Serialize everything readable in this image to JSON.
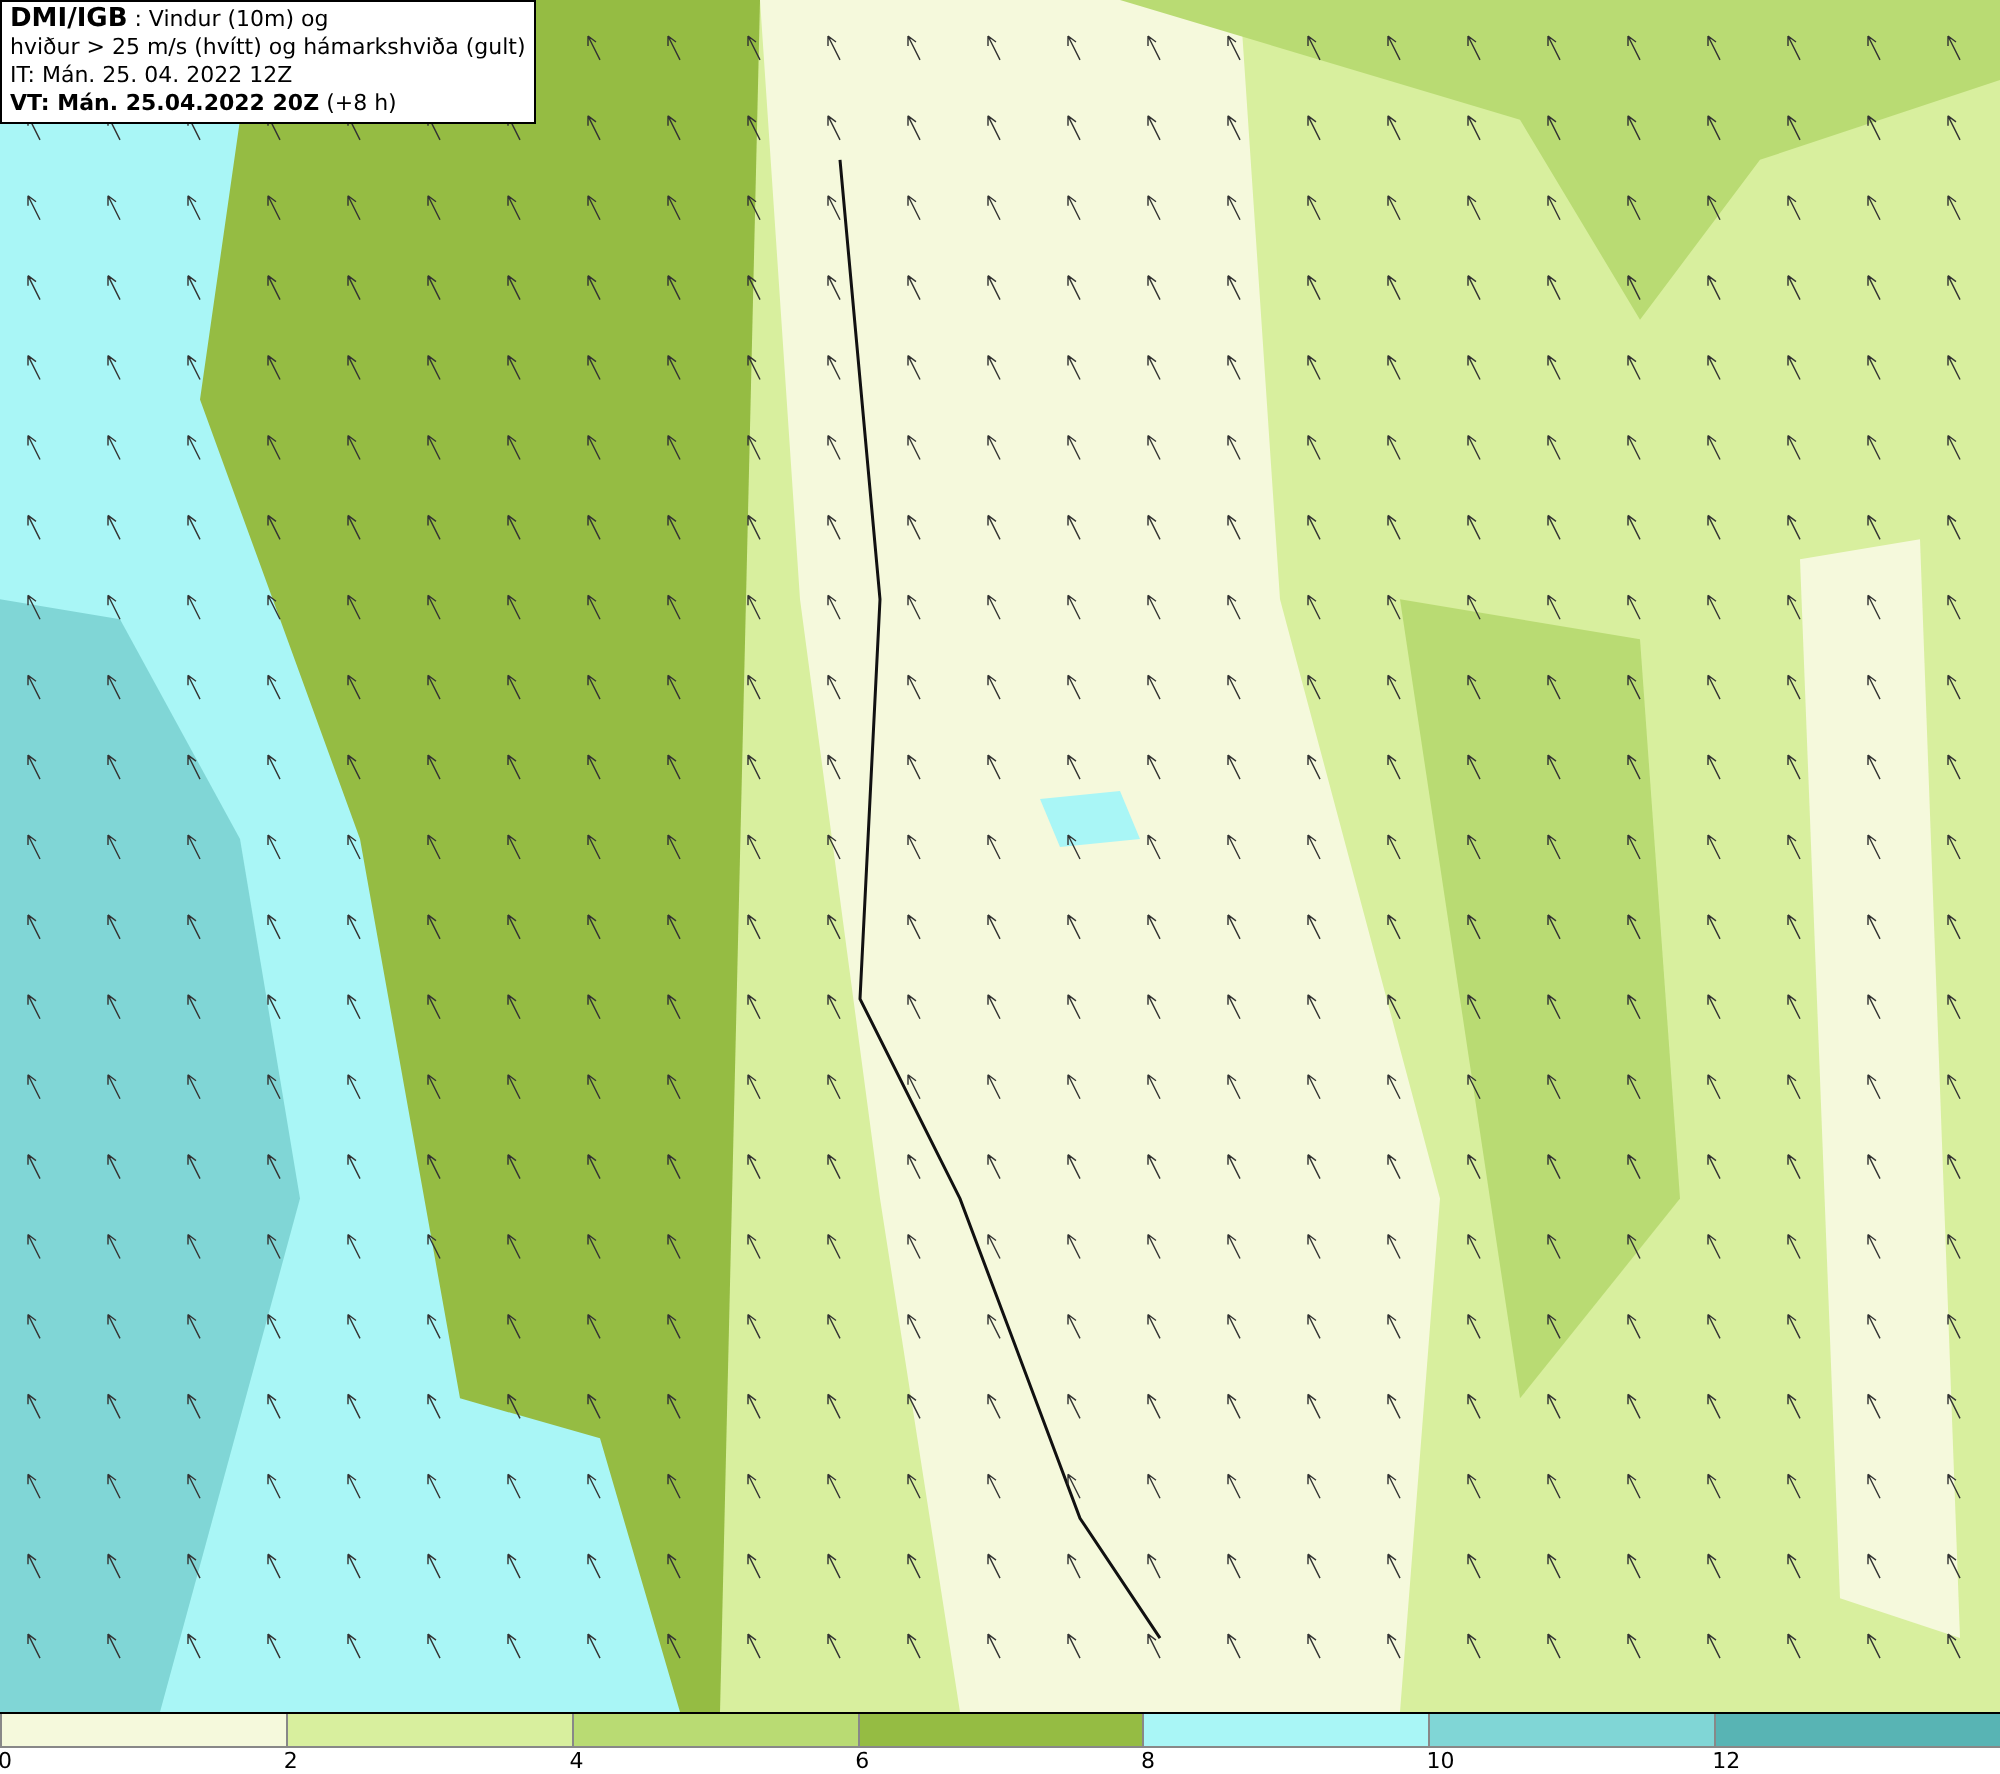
{
  "info": {
    "title": "DMI/IGB",
    "subtitle": ": Vindur (10m) og",
    "line2": "hviður > 25 m/s (hvítt) og hámarkshviða (gult)",
    "initial_time": "IT: Mán. 25. 04. 2022 12Z",
    "valid_time": "VT: Mán. 25.04.2022 20Z",
    "lead": "(+8 h)"
  },
  "legend": {
    "bins": [
      {
        "color": "#f5f9dc",
        "tick": "0"
      },
      {
        "color": "#d8ef9e",
        "tick": "2"
      },
      {
        "color": "#b9db73",
        "tick": "4"
      },
      {
        "color": "#95bc43",
        "tick": "6"
      },
      {
        "color": "#a9f6f6",
        "tick": "8"
      },
      {
        "color": "#80d6d6",
        "tick": "10"
      },
      {
        "color": "#58b4b4",
        "tick": "12"
      }
    ]
  }
}
